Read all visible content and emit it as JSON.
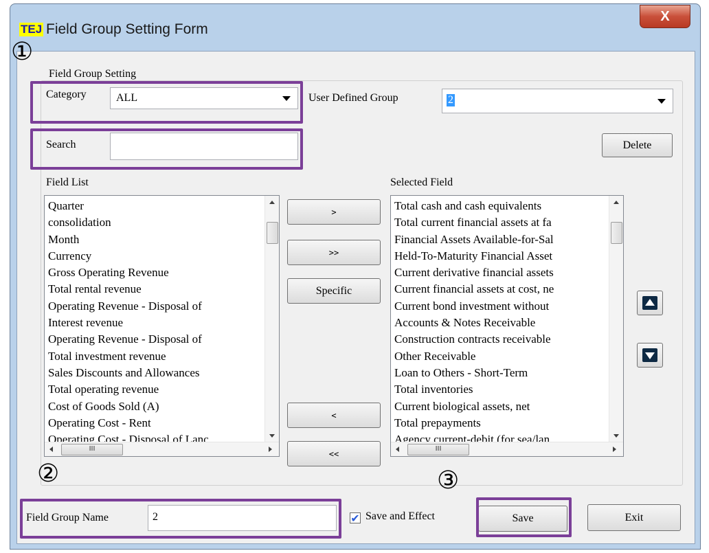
{
  "window": {
    "logo": "TEJ",
    "title": "Field Group Setting Form",
    "close_label": "X"
  },
  "group": {
    "label": "Field Group Setting"
  },
  "category": {
    "label": "Category",
    "value": "ALL"
  },
  "user_defined_group": {
    "label": "User Defined Group",
    "value": "2"
  },
  "search": {
    "label": "Search",
    "value": ""
  },
  "buttons": {
    "delete": "Delete",
    "add_one": ">",
    "add_all": ">>",
    "specific": "Specific",
    "remove_one": "<",
    "remove_all": "<<",
    "save": "Save",
    "exit": "Exit"
  },
  "field_list": {
    "label": "Field List",
    "items": [
      "Quarter",
      "consolidation",
      "Month",
      "Currency",
      "Gross Operating Revenue",
      "Total rental revenue",
      "Operating Revenue - Disposal of",
      "Interest revenue",
      "Operating Revenue - Disposal of",
      "Total investment revenue",
      "Sales Discounts and Allowances",
      "Total operating revenue",
      "Cost of Goods Sold (A)",
      "Operating Cost - Rent",
      "Operating Cost - Disposal of Lanc"
    ]
  },
  "selected_field": {
    "label": "Selected Field",
    "items": [
      "Total cash and cash equivalents",
      "Total current financial assets at fa",
      "Financial Assets Available-for-Sal",
      "Held-To-Maturity Financial Asset",
      "Current derivative financial assets",
      "Current financial assets at cost, ne",
      "Current bond investment without",
      "Accounts & Notes Receivable",
      "Construction contracts receivable",
      "Other Receivable",
      "Loan to Others - Short-Term",
      "Total inventories",
      "Current biological assets, net",
      "Total prepayments",
      "Agency current-debit (for sea/lan"
    ]
  },
  "scrollbar": {
    "thumb_label": "III"
  },
  "field_group_name": {
    "label": "Field Group Name",
    "value": "2"
  },
  "save_and_effect": {
    "label": "Save and Effect",
    "checked": true,
    "check_mark": "✔"
  },
  "annotations": {
    "marker_1": "①",
    "marker_2": "②",
    "marker_3": "③"
  }
}
